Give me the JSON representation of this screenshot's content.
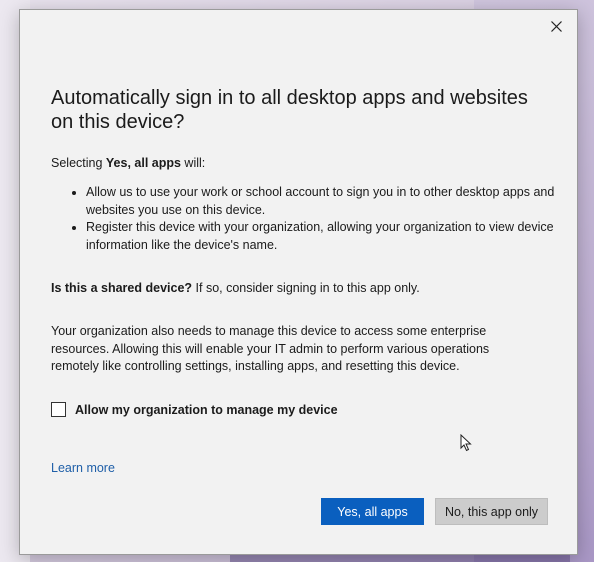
{
  "dialog": {
    "title": "Automatically sign in to all desktop apps and websites on this device?",
    "selecting_prefix": "Selecting ",
    "selecting_bold": "Yes, all apps",
    "selecting_suffix": " will:",
    "bullets": [
      "Allow us to use your work or school account to sign you in to other desktop apps and websites you use on this device.",
      "Register this device with your organization, allowing your organization to view device information like the device's name."
    ],
    "shared_bold": "Is this a shared device?",
    "shared_text": " If so, consider signing in to this app only.",
    "manage_paragraph": "Your organization also needs to manage this device to access some enterprise resources. Allowing this will enable your IT admin to perform various operations remotely like controlling settings, installing apps, and resetting this device.",
    "checkbox_label": "Allow my organization to manage my device",
    "checkbox_checked": false,
    "learn_more": "Learn more",
    "primary_button": "Yes, all apps",
    "secondary_button": "No, this app only"
  },
  "icons": {
    "close": "close-icon",
    "cursor": "mouse-pointer-icon"
  },
  "colors": {
    "dialog_bg": "#f2f2f2",
    "primary": "#0a5fbf",
    "link": "#1f5fa8",
    "secondary_bg": "#cccccc"
  }
}
